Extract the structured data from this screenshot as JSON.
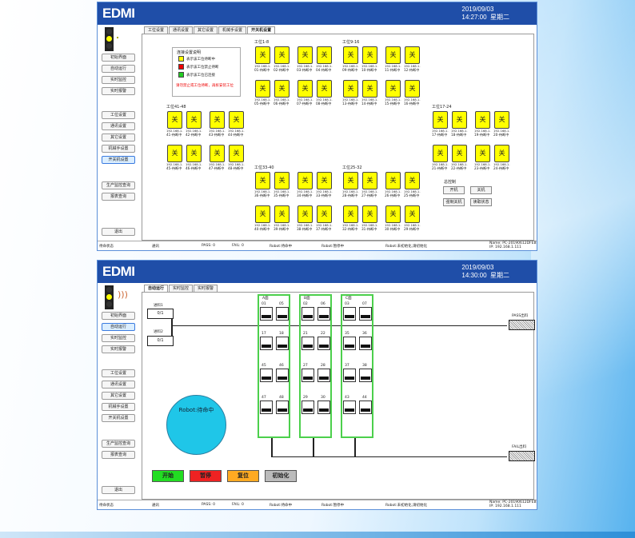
{
  "brand": "EDMI",
  "win1": {
    "date": "2019/09/03",
    "time": "14:27:00",
    "weekday": "星期二",
    "sidebar": [
      "初始界面",
      "自动运行",
      "实时监控",
      "实时报警",
      "工位设置",
      "通讯设置",
      "其它设置",
      "机械手设置",
      "开关机设置",
      "生产监控查询",
      "报表查询",
      "退出"
    ],
    "tabs": [
      "工位设置",
      "通讯设置",
      "其它设置",
      "机械手设置",
      "开关机设置"
    ],
    "legend": {
      "title": "连接设置说明",
      "items": [
        "表示该工位待断中",
        "表示该工位禁止待断",
        "表示该工位已连接"
      ],
      "warning": "请勿禁止或工位待断，再拆安装工位"
    },
    "groups": [
      "工位1-8",
      "工位9-16",
      "工位41-48",
      "工位17-24",
      "工位33-40",
      "工位25-32"
    ],
    "switch_label": "关",
    "ip": "192.168.1.1",
    "stations": {
      "g1": [
        "01-待断中",
        "02-待断中",
        "03-待断中",
        "04-待断中",
        "05-待断中",
        "06-待断中",
        "07-待断中",
        "08-待断中"
      ],
      "g2": [
        "09-待断中",
        "10-待断中",
        "11-待断中",
        "12-待断中",
        "13-待断中",
        "14-待断中",
        "15-待断中",
        "16-待断中"
      ],
      "g3": [
        "41-待断中",
        "42-待断中",
        "43-待断中",
        "44-待断中",
        "45-待断中",
        "46-待断中",
        "47-待断中",
        "48-待断中"
      ],
      "g4": [
        "17-待断中",
        "18-待断中",
        "19-待断中",
        "20-待断中",
        "21-待断中",
        "22-待断中",
        "23-待断中",
        "24-待断中"
      ],
      "g5": [
        "36-待断中",
        "35-待断中",
        "34-待断中",
        "33-待断中",
        "40-待断中",
        "39-待断中",
        "38-待断中",
        "37-待断中"
      ],
      "g6": [
        "28-待断中",
        "27-待断中",
        "26-待断中",
        "25-待断中",
        "32-待断中",
        "31-待断中",
        "30-待断中",
        "29-待断中"
      ]
    },
    "ctrl": {
      "title": "总控制",
      "open": "开机",
      "close": "关机",
      "force": "强制关机",
      "read": "读取状态"
    },
    "status": {
      "state": "待命状态",
      "comm": "通讯",
      "pass": "PASS: 0",
      "fail": "FAIL: 0",
      "robot1": "Robot:待命中",
      "robot2": "Robot:暂停中",
      "robot3": "Robot:未初始化,请初始化",
      "name": "Name: PC-20190612DFEB",
      "ip": "IP: 192.168.1.111"
    }
  },
  "win2": {
    "date": "2019/09/03",
    "time": "14:30:00",
    "weekday": "星期二",
    "tabs": [
      "自动运行",
      "实时监控",
      "实时报警"
    ],
    "in1": {
      "label": "进料1",
      "value": "0/1"
    },
    "in2": {
      "label": "进料2",
      "value": "0/1"
    },
    "pass_out": "PASS出料",
    "fail_out": "FAIL出料",
    "racks": [
      {
        "name": "A面",
        "slots": [
          "01",
          "05",
          "17",
          "18",
          "45",
          "46",
          "47",
          "48"
        ]
      },
      {
        "name": "B面",
        "slots": [
          "02",
          "06",
          "21",
          "22",
          "27",
          "28",
          "29",
          "30"
        ]
      },
      {
        "name": "C面",
        "slots": [
          "03",
          "07",
          "35",
          "36",
          "37",
          "38",
          "43",
          "44"
        ]
      }
    ],
    "robot": "Robot:待命中",
    "buttons": [
      "开始",
      "暂停",
      "复位",
      "初始化"
    ],
    "btn_colors": [
      "#22dd22",
      "#ee2222",
      "#ffaa22",
      "#bbbbbb"
    ]
  }
}
